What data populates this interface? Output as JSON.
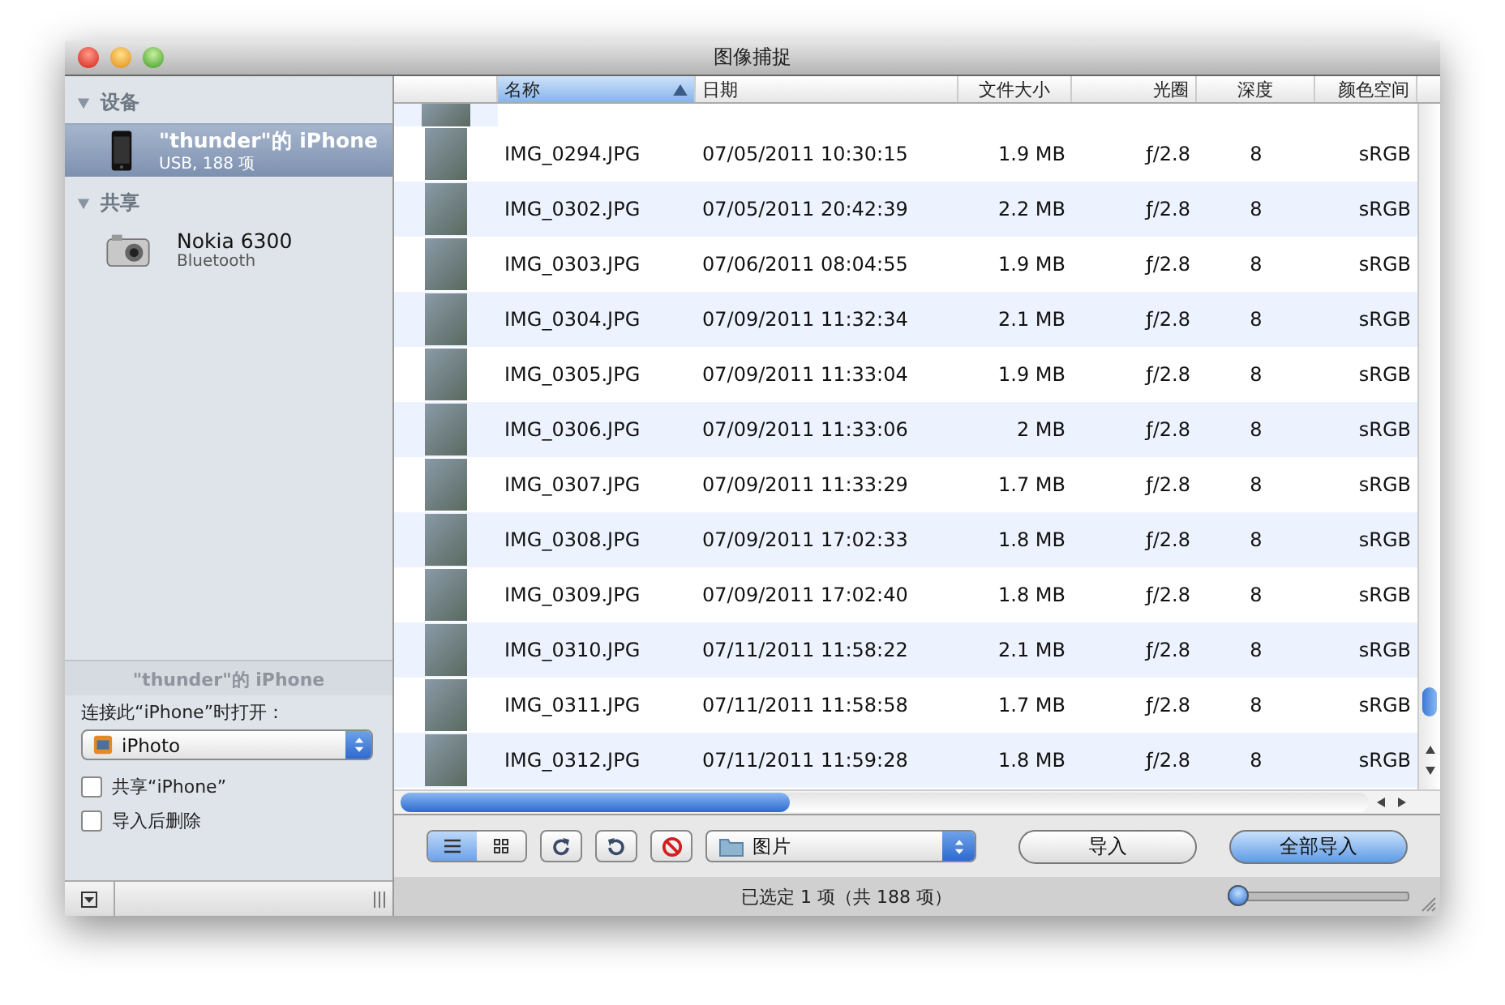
{
  "window": {
    "title": "图像捕捉"
  },
  "sidebar": {
    "sections": [
      {
        "title": "设备",
        "items": [
          {
            "kind": "phone",
            "name": "\"thunder\"的 iPhone",
            "detail": "USB, 188 项",
            "selected": true
          }
        ]
      },
      {
        "title": "共享",
        "items": [
          {
            "kind": "camera",
            "name": "Nokia 6300",
            "detail": "Bluetooth",
            "selected": false
          }
        ]
      }
    ],
    "device_panel": {
      "title": "\"thunder\"的 iPhone",
      "open_label": "连接此“iPhone”时打开：",
      "open_app": "iPhoto",
      "options": [
        {
          "label": "共享“iPhone”",
          "checked": false
        },
        {
          "label": "导入后删除",
          "checked": false
        }
      ]
    }
  },
  "table": {
    "columns": [
      {
        "label": "名称",
        "selected": true
      },
      {
        "label": "日期",
        "selected": false
      },
      {
        "label": "文件大小",
        "selected": false
      },
      {
        "label": "光圈",
        "selected": false
      },
      {
        "label": "深度",
        "selected": false
      },
      {
        "label": "颜色空间",
        "selected": false
      }
    ],
    "rows": [
      {
        "name": "IMG_0294.JPG",
        "date": "07/05/2011 10:30:15",
        "size": "1.9 MB",
        "aperture": "ƒ/2.8",
        "depth": "8",
        "color_space": "sRGB"
      },
      {
        "name": "IMG_0302.JPG",
        "date": "07/05/2011 20:42:39",
        "size": "2.2 MB",
        "aperture": "ƒ/2.8",
        "depth": "8",
        "color_space": "sRGB"
      },
      {
        "name": "IMG_0303.JPG",
        "date": "07/06/2011 08:04:55",
        "size": "1.9 MB",
        "aperture": "ƒ/2.8",
        "depth": "8",
        "color_space": "sRGB"
      },
      {
        "name": "IMG_0304.JPG",
        "date": "07/09/2011 11:32:34",
        "size": "2.1 MB",
        "aperture": "ƒ/2.8",
        "depth": "8",
        "color_space": "sRGB"
      },
      {
        "name": "IMG_0305.JPG",
        "date": "07/09/2011 11:33:04",
        "size": "1.9 MB",
        "aperture": "ƒ/2.8",
        "depth": "8",
        "color_space": "sRGB"
      },
      {
        "name": "IMG_0306.JPG",
        "date": "07/09/2011 11:33:06",
        "size": "2 MB",
        "aperture": "ƒ/2.8",
        "depth": "8",
        "color_space": "sRGB"
      },
      {
        "name": "IMG_0307.JPG",
        "date": "07/09/2011 11:33:29",
        "size": "1.7 MB",
        "aperture": "ƒ/2.8",
        "depth": "8",
        "color_space": "sRGB"
      },
      {
        "name": "IMG_0308.JPG",
        "date": "07/09/2011 17:02:33",
        "size": "1.8 MB",
        "aperture": "ƒ/2.8",
        "depth": "8",
        "color_space": "sRGB"
      },
      {
        "name": "IMG_0309.JPG",
        "date": "07/09/2011 17:02:40",
        "size": "1.8 MB",
        "aperture": "ƒ/2.8",
        "depth": "8",
        "color_space": "sRGB"
      },
      {
        "name": "IMG_0310.JPG",
        "date": "07/11/2011 11:58:22",
        "size": "2.1 MB",
        "aperture": "ƒ/2.8",
        "depth": "8",
        "color_space": "sRGB"
      },
      {
        "name": "IMG_0311.JPG",
        "date": "07/11/2011 11:58:58",
        "size": "1.7 MB",
        "aperture": "ƒ/2.8",
        "depth": "8",
        "color_space": "sRGB"
      },
      {
        "name": "IMG_0312.JPG",
        "date": "07/11/2011 11:59:28",
        "size": "1.8 MB",
        "aperture": "ƒ/2.8",
        "depth": "8",
        "color_space": "sRGB"
      }
    ]
  },
  "toolbar": {
    "views": [
      {
        "kind": "list",
        "selected": true
      },
      {
        "kind": "grid",
        "selected": false
      }
    ],
    "destination": "图片",
    "import": "导入",
    "import_all": "全部导入"
  },
  "status_bar": {
    "text": "已选定 1 项（共 188 项）",
    "zoom": {
      "level": 0
    }
  }
}
